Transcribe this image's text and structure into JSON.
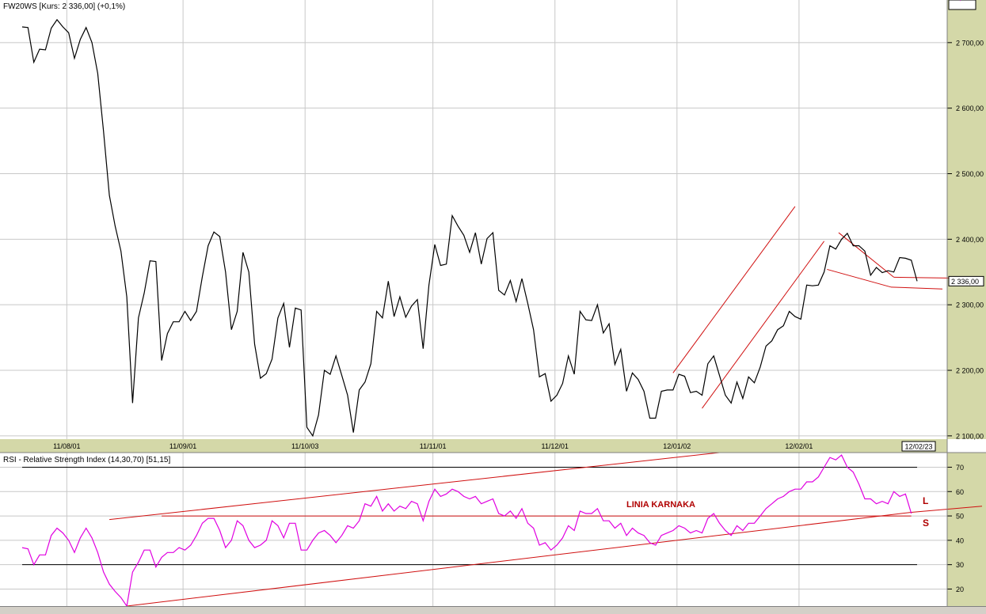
{
  "colors": {
    "background": "#ffffff",
    "axis_background": "#d4d8a8",
    "price_line": "#000000",
    "rsi_line": "#e000e0",
    "trendlines": "#d01010",
    "annotation": "#b00000",
    "grid": "#c8c8c8",
    "rsi_levels": "#000000"
  },
  "chart_data": [
    {
      "type": "line",
      "title": "FW20WS [Kurs: 2 336,00] (+0,1%)",
      "xlabel": "",
      "ylabel": "",
      "x_tick_labels": [
        "11/08/01",
        "11/09/01",
        "11/10/03",
        "11/11/01",
        "11/12/01",
        "12/01/02",
        "12/02/01"
      ],
      "y_tick_labels": [
        "2 700,00",
        "2 600,00",
        "2 500,00",
        "2 400,00",
        "2 300,00",
        "2 200,00",
        "2 100,00"
      ],
      "y_ticks": [
        2700,
        2600,
        2500,
        2400,
        2300,
        2200,
        2100
      ],
      "ylim": [
        2095,
        2765
      ],
      "grid": true,
      "last_value_label": "2 336,00",
      "last_date_label": "12/02/23",
      "series": [
        {
          "values": [
            2724,
            2723,
            2670,
            2690,
            2689,
            2722,
            2735,
            2724,
            2715,
            2676,
            2705,
            2723,
            2700,
            2653,
            2565,
            2467,
            2420,
            2382,
            2312,
            2150,
            2280,
            2318,
            2367,
            2366,
            2215,
            2256,
            2274,
            2274,
            2290,
            2276,
            2290,
            2343,
            2390,
            2411,
            2404,
            2350,
            2262,
            2290,
            2380,
            2350,
            2240,
            2188,
            2195,
            2217,
            2280,
            2302,
            2235,
            2295,
            2292,
            2113,
            2100,
            2132,
            2200,
            2194,
            2222,
            2192,
            2162,
            2105,
            2170,
            2182,
            2210,
            2290,
            2280,
            2336,
            2282,
            2312,
            2281,
            2298,
            2308,
            2233,
            2330,
            2392,
            2360,
            2362,
            2436,
            2420,
            2406,
            2380,
            2410,
            2362,
            2401,
            2410,
            2322,
            2315,
            2337,
            2305,
            2340,
            2302,
            2262,
            2190,
            2195,
            2153,
            2162,
            2180,
            2222,
            2194,
            2290,
            2277,
            2276,
            2300,
            2257,
            2271,
            2209,
            2232,
            2168,
            2196,
            2186,
            2168,
            2127,
            2127,
            2168,
            2170,
            2170,
            2194,
            2191,
            2166,
            2168,
            2162,
            2210,
            2222,
            2192,
            2162,
            2150,
            2182,
            2157,
            2190,
            2181,
            2205,
            2237,
            2245,
            2262,
            2268,
            2290,
            2282,
            2278,
            2330,
            2329,
            2330,
            2350,
            2390,
            2385,
            2400,
            2409,
            2390,
            2390,
            2382,
            2345,
            2357,
            2349,
            2352,
            2350,
            2372,
            2371,
            2368,
            2336
          ]
        }
      ]
    },
    {
      "type": "line",
      "title": "RSI - Relative Strength Index (14,30,70) [51,15]",
      "xlabel": "",
      "ylabel": "",
      "y_tick_labels": [
        "70",
        "60",
        "50",
        "40",
        "30",
        "20"
      ],
      "y_ticks": [
        70,
        60,
        50,
        40,
        30,
        20
      ],
      "ylim": [
        13,
        76
      ],
      "levels": [
        70,
        30
      ],
      "last_value_label": "51,15",
      "annotations": {
        "linia": "LINIA KARNAKA",
        "long": "L",
        "short": "S"
      },
      "series": [
        {
          "values": [
            37,
            36.5,
            30,
            34,
            34,
            42,
            45,
            43,
            40,
            35,
            41,
            45,
            41,
            35,
            27,
            22,
            19,
            16.5,
            13,
            27,
            31,
            36,
            36,
            29,
            33,
            35,
            35,
            37,
            36,
            38,
            42,
            47,
            49,
            49,
            44,
            37,
            40,
            48,
            46,
            40,
            37,
            38,
            40,
            48,
            46,
            41,
            47,
            47,
            36,
            36,
            40,
            43,
            44,
            42,
            39,
            42,
            46,
            45,
            48,
            55,
            54,
            58,
            52,
            55,
            52,
            54,
            53,
            56,
            55,
            48,
            56,
            61,
            58,
            59,
            61,
            60,
            58,
            57,
            58,
            55,
            56,
            57,
            51,
            50,
            52,
            49,
            53,
            47,
            45,
            38,
            39,
            36,
            38,
            41,
            46,
            44,
            52,
            51,
            51,
            53,
            48,
            48,
            45,
            47,
            42,
            45,
            43,
            42,
            39,
            38,
            42,
            43,
            44,
            46,
            45,
            43,
            44,
            43,
            49,
            51,
            47,
            44,
            42,
            46,
            44,
            47,
            47,
            50,
            53,
            55,
            57,
            58,
            60,
            61,
            61,
            64,
            64,
            66,
            70,
            74,
            73,
            75,
            70,
            68,
            63,
            57,
            57,
            55,
            56,
            55,
            60,
            58,
            59,
            51
          ]
        }
      ]
    }
  ]
}
